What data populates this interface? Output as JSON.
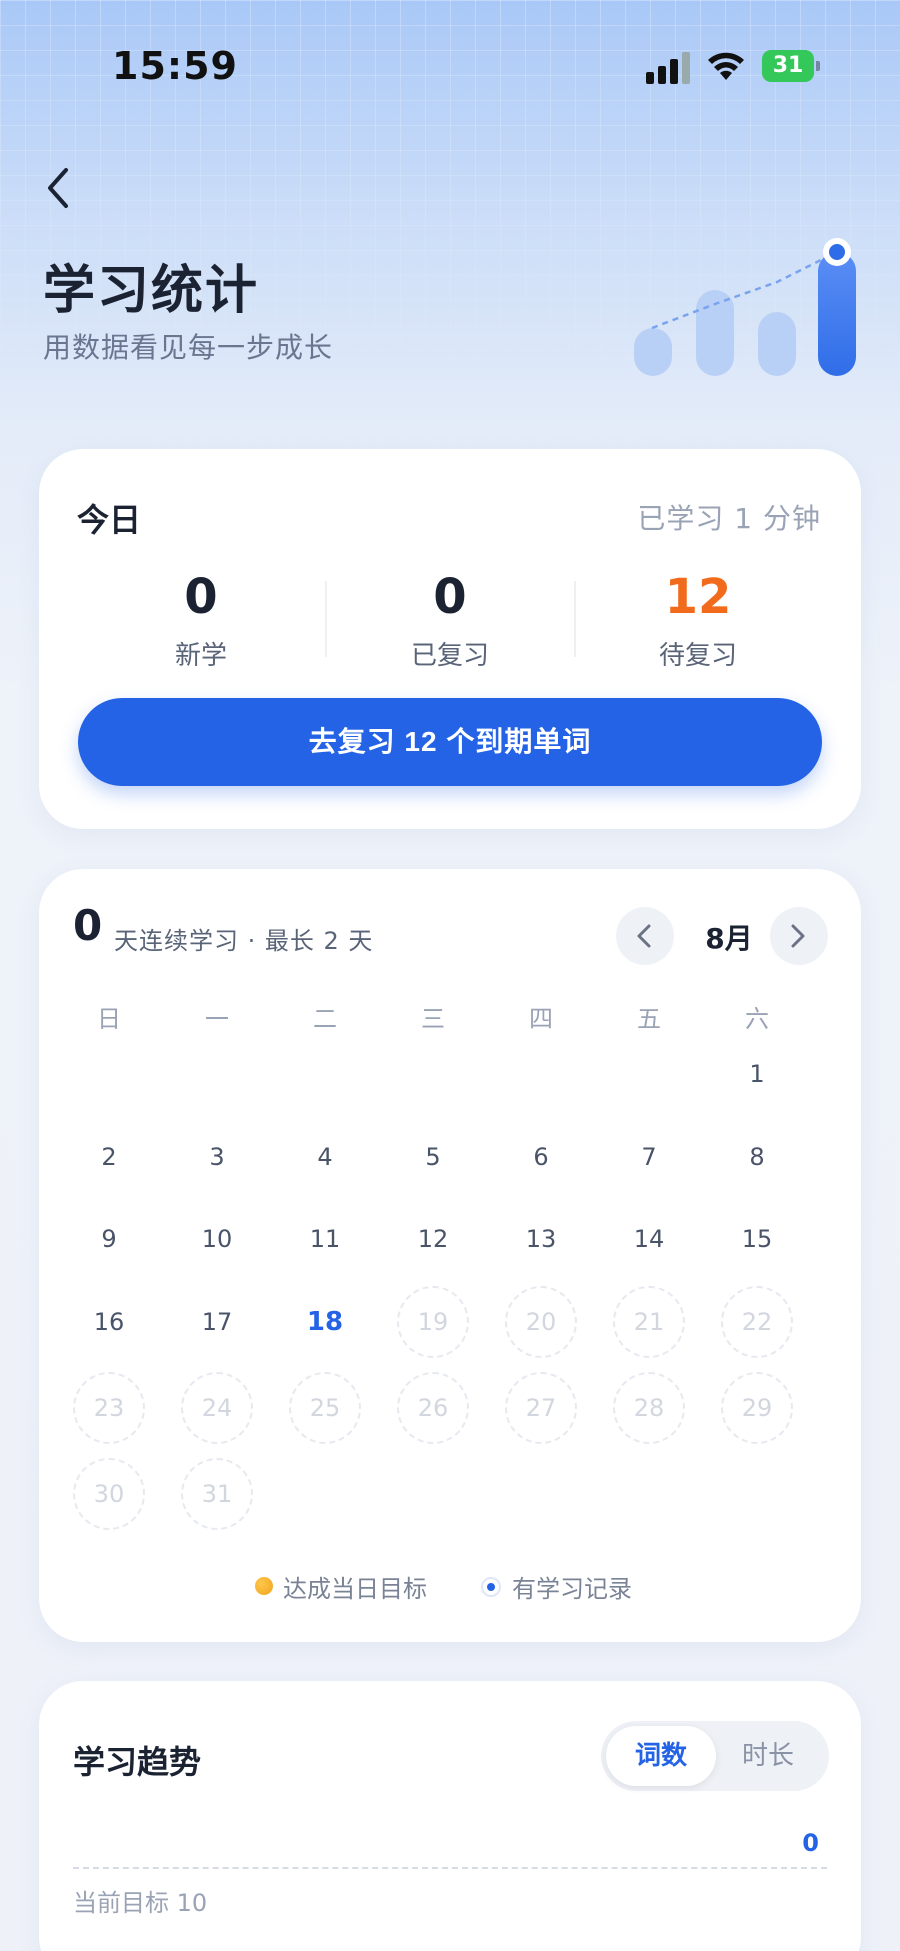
{
  "status_bar": {
    "time": "15:59",
    "battery": "31"
  },
  "header": {
    "title": "学习统计",
    "subtitle": "用数据看见每一步成长"
  },
  "today": {
    "label": "今日",
    "studied_time": "已学习 1 分钟",
    "stats": [
      {
        "value": "0",
        "label": "新学"
      },
      {
        "value": "0",
        "label": "已复习"
      },
      {
        "value": "12",
        "label": "待复习"
      }
    ],
    "review_button": "去复习 12 个到期单词"
  },
  "calendar": {
    "streak": "0",
    "streak_text": "天连续学习 · 最长 2 天",
    "month": "8月",
    "weekdays": [
      "日",
      "一",
      "二",
      "三",
      "四",
      "五",
      "六"
    ],
    "first_weekday": 6,
    "days_in_month": 31,
    "today": 18,
    "legend": {
      "goal": "达成当日目标",
      "record": "有学习记录"
    },
    "colors": {
      "goal": "#f0a420",
      "record": "#2463e6"
    }
  },
  "trend": {
    "title": "学习趋势",
    "tabs": [
      "词数",
      "时长"
    ],
    "active_tab": "词数",
    "value": "0",
    "goal_label": "当前目标 10"
  },
  "colors": {
    "primary": "#2463e6",
    "orange": "#f26a1b"
  },
  "icons": {
    "back": "chevron-left-icon",
    "prev": "chevron-left-icon",
    "next": "chevron-right-icon"
  }
}
